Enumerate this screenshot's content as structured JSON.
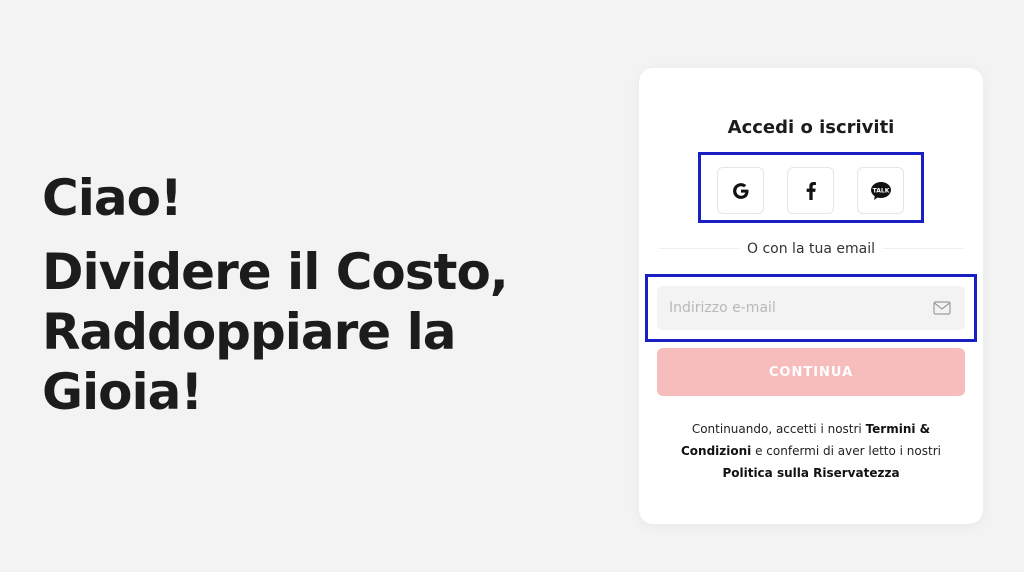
{
  "hero": {
    "greeting": "Ciao!",
    "tagline": "Dividere il Costo, Raddoppiare la Gioia!"
  },
  "card": {
    "title": "Accedi o iscriviti",
    "social": [
      {
        "name": "google",
        "icon": "google-icon"
      },
      {
        "name": "facebook",
        "icon": "facebook-icon"
      },
      {
        "name": "kakaotalk",
        "icon": "kakaotalk-icon",
        "label": "TALK"
      }
    ],
    "divider_text": "O con la tua email",
    "email": {
      "placeholder": "Indirizzo e-mail",
      "value": "",
      "icon": "mail-icon"
    },
    "continue_label": "CONTINUA",
    "legal": {
      "prefix": "Continuando, accetti i nostri ",
      "terms_link": "Termini & Condizioni",
      "middle": " e confermi di aver letto i nostri ",
      "privacy_link": "Politica sulla Riservatezza"
    }
  },
  "colors": {
    "background": "#f3f3f3",
    "card": "#ffffff",
    "continue_button": "#f7bcbc",
    "highlight_box": "#1a1fc4",
    "text": "#1c1c1c"
  }
}
